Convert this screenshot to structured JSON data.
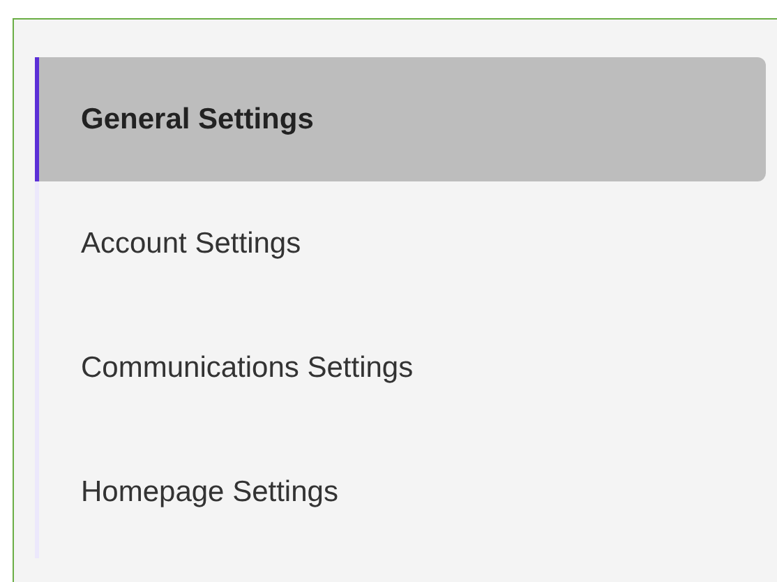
{
  "nav": {
    "items": [
      {
        "label": "General Settings",
        "selected": true
      },
      {
        "label": "Account Settings",
        "selected": false
      },
      {
        "label": "Communications Settings",
        "selected": false
      },
      {
        "label": "Homepage Settings",
        "selected": false
      }
    ]
  }
}
